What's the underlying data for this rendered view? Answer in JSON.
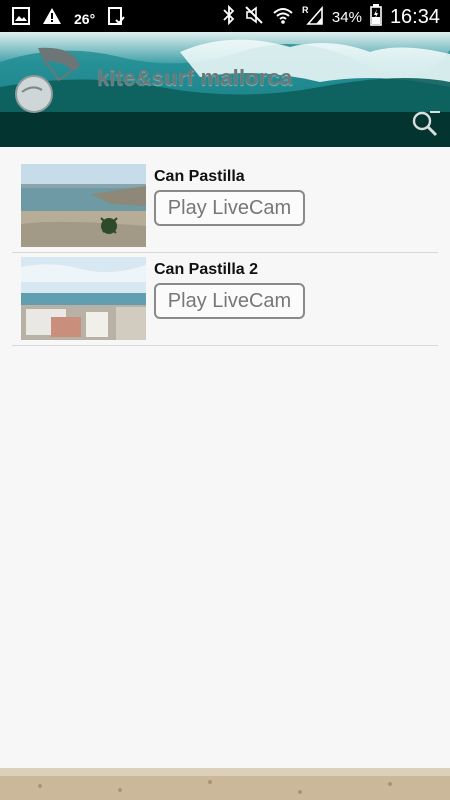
{
  "status_bar": {
    "temperature": "26°",
    "battery": "34%",
    "time": "16:34",
    "icons": [
      "image-icon",
      "warning-icon",
      "clipboard-check-icon",
      "bluetooth-icon",
      "mute-icon",
      "wifi-icon",
      "signal-icon",
      "battery-icon"
    ]
  },
  "header": {
    "brand_text": "kite&surf mallorca",
    "search_icon": "search-icon"
  },
  "webcams": [
    {
      "title": "Can Pastilla",
      "button_label": "Play LiveCam"
    },
    {
      "title": "Can Pastilla 2",
      "button_label": "Play LiveCam"
    }
  ],
  "colors": {
    "status_bar_bg": "#000000",
    "header_bg": "#03342f",
    "list_bg": "#f7f7f7",
    "button_border": "#8a8a8a"
  }
}
